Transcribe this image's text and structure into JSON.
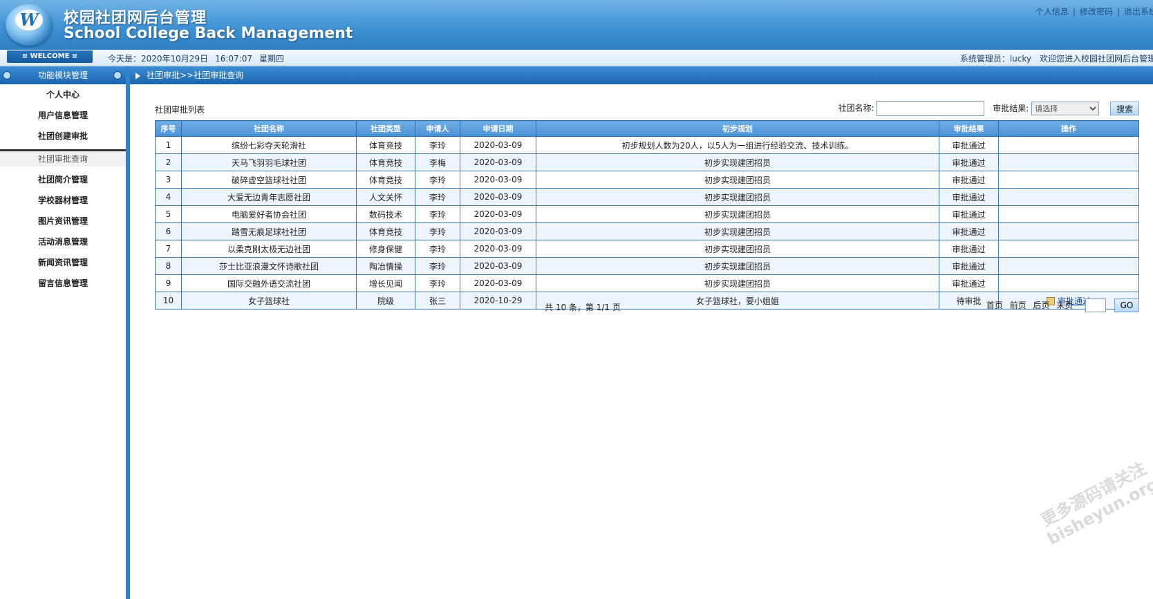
{
  "header": {
    "logo_letter": "W",
    "title_cn": "校园社团网后台管理",
    "title_en": "School College Back Management",
    "links": [
      "个人信息",
      "修改密码",
      "退出系统"
    ]
  },
  "statusbar": {
    "welcome": "≡ WELCOME ≡",
    "today_label": "今天是：2020年10月29日",
    "time": "16:07:07",
    "weekday": "星期四",
    "admin": "系统管理员：lucky　欢迎您进入校园社团网后台管理"
  },
  "sidebar": {
    "heading": "功能模块管理",
    "items": [
      "个人中心",
      "用户信息管理",
      "社团创建审批",
      "社团审批查询",
      "社团简介管理",
      "学校器材管理",
      "图片资讯管理",
      "活动消息管理",
      "新闻资讯管理",
      "留言信息管理"
    ]
  },
  "main": {
    "breadcrumb": "社团审批>>社团审批查询",
    "list_title": "社团审批列表",
    "search": {
      "name_label": "社团名称:",
      "result_label": "审批结果:",
      "select_value": "请选择",
      "button": "搜索"
    },
    "table": {
      "headers": [
        "序号",
        "社团名称",
        "社团类型",
        "申请人",
        "申请日期",
        "初步规划",
        "审批结果",
        "操作"
      ],
      "rows": [
        [
          "1",
          "缤纷七彩夺天轮滑社",
          "体育竞技",
          "李玲",
          "2020-03-09",
          "初步规划人数为20人，以5人为一组进行经验交流、技术训练。",
          "审批通过",
          ""
        ],
        [
          "2",
          "天马飞羽羽毛球社团",
          "体育竞技",
          "李梅",
          "2020-03-09",
          "初步实现建团招员",
          "审批通过",
          ""
        ],
        [
          "3",
          "破碎虚空篮球社社团",
          "体育竞技",
          "李玲",
          "2020-03-09",
          "初步实现建团招员",
          "审批通过",
          ""
        ],
        [
          "4",
          "大爱无边青年志愿社团",
          "人文关怀",
          "李玲",
          "2020-03-09",
          "初步实现建团招员",
          "审批通过",
          ""
        ],
        [
          "5",
          "电脑爱好者协会社团",
          "数码技术",
          "李玲",
          "2020-03-09",
          "初步实现建团招员",
          "审批通过",
          ""
        ],
        [
          "6",
          "踏雪无痕足球社社团",
          "体育竞技",
          "李玲",
          "2020-03-09",
          "初步实现建团招员",
          "审批通过",
          ""
        ],
        [
          "7",
          "以柔克刚太极无边社团",
          "修身保健",
          "李玲",
          "2020-03-09",
          "初步实现建团招员",
          "审批通过",
          ""
        ],
        [
          "8",
          "莎士比亚浪漫文怀诗歌社团",
          "陶冶情操",
          "李玲",
          "2020-03-09",
          "初步实现建团招员",
          "审批通过",
          ""
        ],
        [
          "9",
          "国际交融外语交流社团",
          "增长见闻",
          "李玲",
          "2020-03-09",
          "初步实现建团招员",
          "审批通过",
          ""
        ],
        [
          "10",
          "女子篮球社",
          "院级",
          "张三",
          "2020-10-29",
          "女子篮球社，要小姐姐",
          "待审批",
          "审批通过"
        ]
      ]
    },
    "pager": {
      "info": "共 10 条，第 1/1 页",
      "first": "首页",
      "prev": "前页",
      "next": "后页",
      "last": "末页",
      "go": "GO"
    }
  },
  "watermark": [
    "更多源码请关注",
    "bisheyun.org"
  ]
}
